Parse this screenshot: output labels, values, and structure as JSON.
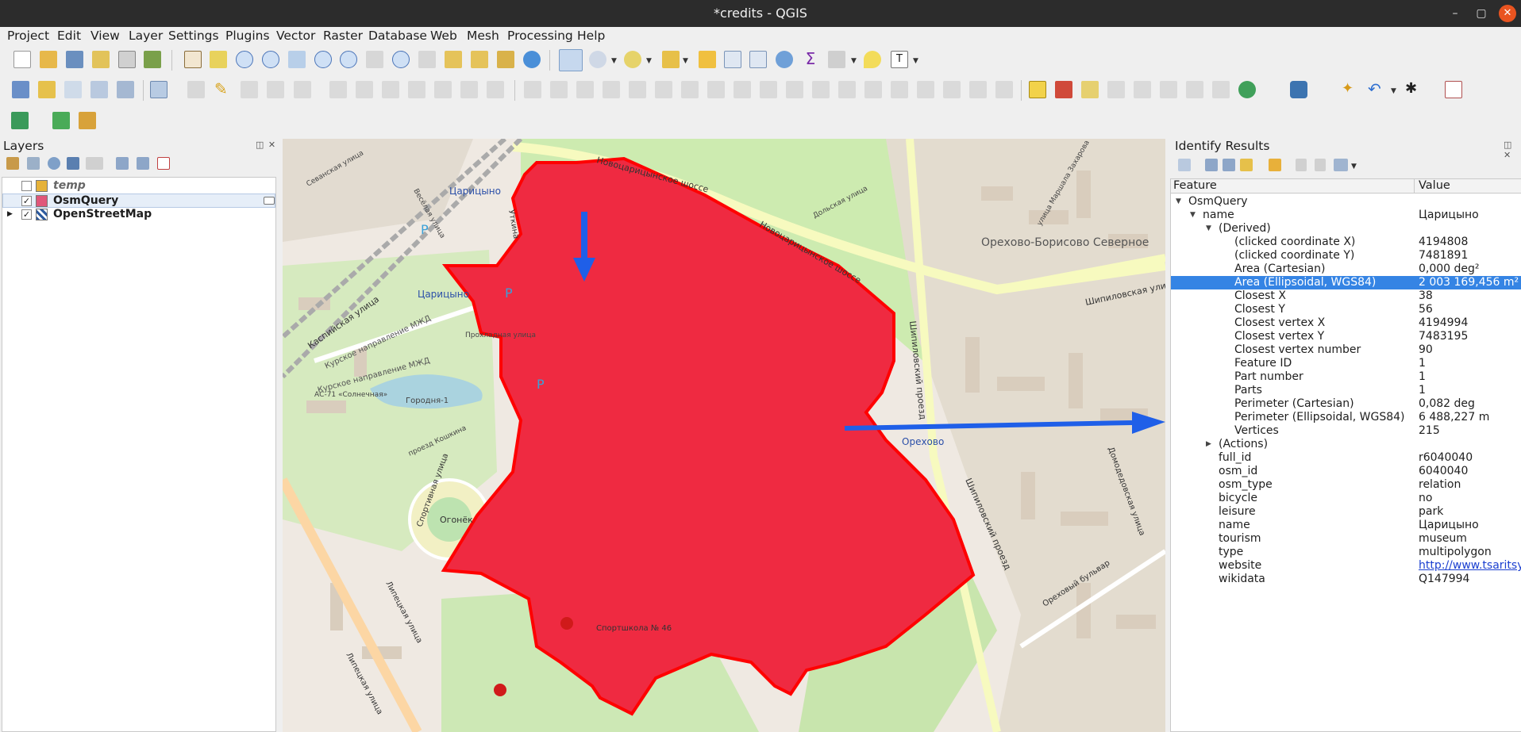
{
  "window": {
    "title": "*credits - QGIS",
    "minimize": "–",
    "maximize": "▢",
    "close": "✕"
  },
  "menu": [
    "Project",
    "Edit",
    "View",
    "Layer",
    "Settings",
    "Plugins",
    "Vector",
    "Raster",
    "Database",
    "Web",
    "Mesh",
    "Processing",
    "Help"
  ],
  "layers_panel": {
    "title": "Layers",
    "header_buttons": "◫ ✕",
    "layers": [
      {
        "name": "temp",
        "checked": false,
        "color": "#e6b23a",
        "italic": true
      },
      {
        "name": "OsmQuery",
        "checked": true,
        "color": "#e0577a",
        "italic": false,
        "selected": true
      },
      {
        "name": "OpenStreetMap",
        "checked": true,
        "color": "#2d5a9e",
        "italic": false
      }
    ]
  },
  "map": {
    "labels": [
      "Новоцарицынское шоссе",
      "Новоцарицынское шоссе",
      "Шипиловская улица",
      "Шипиловский проезд",
      "Шипиловский проезд",
      "Каспийская улица",
      "Курское направление МЖД",
      "Курское направление МЖД",
      "Царицыно",
      "Царицыно",
      "Орехово-Борисово Северное",
      "Орехово",
      "Огонёк",
      "Спортивная улица",
      "Липецкая улица",
      "Липецкая улица",
      "Ореховый бульвар",
      "Домодедовская улица",
      "Спортшкола № 46",
      "Городня-1",
      "Прохладная улица",
      "Севанская улица",
      "Весёлая улица",
      "Дольская улица",
      "улица Маршала Захарова",
      "АС-71 «Солнечная»",
      "проезд Кошкина",
      "P",
      "P",
      "P",
      "Уткина"
    ]
  },
  "identify_panel": {
    "title": "Identify Results",
    "header_buttons": "◫ ✕",
    "columns": [
      "Feature",
      "Value"
    ],
    "rows": [
      {
        "level": 0,
        "expander": "▼",
        "feature": "OsmQuery",
        "value": ""
      },
      {
        "level": 1,
        "expander": "▼",
        "feature": "name",
        "value": "Царицыно"
      },
      {
        "level": 2,
        "expander": "▼",
        "feature": "(Derived)",
        "value": ""
      },
      {
        "level": 3,
        "feature": "(clicked coordinate X)",
        "value": "4194808"
      },
      {
        "level": 3,
        "feature": "(clicked coordinate Y)",
        "value": "7481891"
      },
      {
        "level": 3,
        "feature": "Area (Cartesian)",
        "value": "0,000 deg²"
      },
      {
        "level": 3,
        "feature": "Area (Ellipsoidal, WGS84)",
        "value": "2 003 169,456 m²",
        "selected": true
      },
      {
        "level": 3,
        "feature": "Closest X",
        "value": "38"
      },
      {
        "level": 3,
        "feature": "Closest Y",
        "value": "56"
      },
      {
        "level": 3,
        "feature": "Closest vertex X",
        "value": "4194994"
      },
      {
        "level": 3,
        "feature": "Closest vertex Y",
        "value": "7483195"
      },
      {
        "level": 3,
        "feature": "Closest vertex number",
        "value": "90"
      },
      {
        "level": 3,
        "feature": "Feature ID",
        "value": "1"
      },
      {
        "level": 3,
        "feature": "Part number",
        "value": "1"
      },
      {
        "level": 3,
        "feature": "Parts",
        "value": "1"
      },
      {
        "level": 3,
        "feature": "Perimeter (Cartesian)",
        "value": "0,082 deg"
      },
      {
        "level": 3,
        "feature": "Perimeter (Ellipsoidal, WGS84)",
        "value": "6 488,227 m"
      },
      {
        "level": 3,
        "feature": "Vertices",
        "value": "215"
      },
      {
        "level": 2,
        "expander": "▶",
        "feature": "(Actions)",
        "value": ""
      },
      {
        "level": 2,
        "feature": "full_id",
        "value": "r6040040"
      },
      {
        "level": 2,
        "feature": "osm_id",
        "value": "6040040"
      },
      {
        "level": 2,
        "feature": "osm_type",
        "value": "relation"
      },
      {
        "level": 2,
        "feature": "bicycle",
        "value": "no"
      },
      {
        "level": 2,
        "feature": "leisure",
        "value": "park"
      },
      {
        "level": 2,
        "feature": "name",
        "value": "Царицыно"
      },
      {
        "level": 2,
        "feature": "tourism",
        "value": "museum"
      },
      {
        "level": 2,
        "feature": "type",
        "value": "multipolygon"
      },
      {
        "level": 2,
        "feature": "website",
        "value": "http://www.tsaritsyno.ru",
        "link": true
      },
      {
        "level": 2,
        "feature": "wikidata",
        "value": "Q147994"
      }
    ]
  },
  "colors": {
    "polygon_fill": "#ef2a41",
    "polygon_stroke": "#ff0000",
    "arrow": "#1f5fe8",
    "selection": "#3584e4"
  }
}
